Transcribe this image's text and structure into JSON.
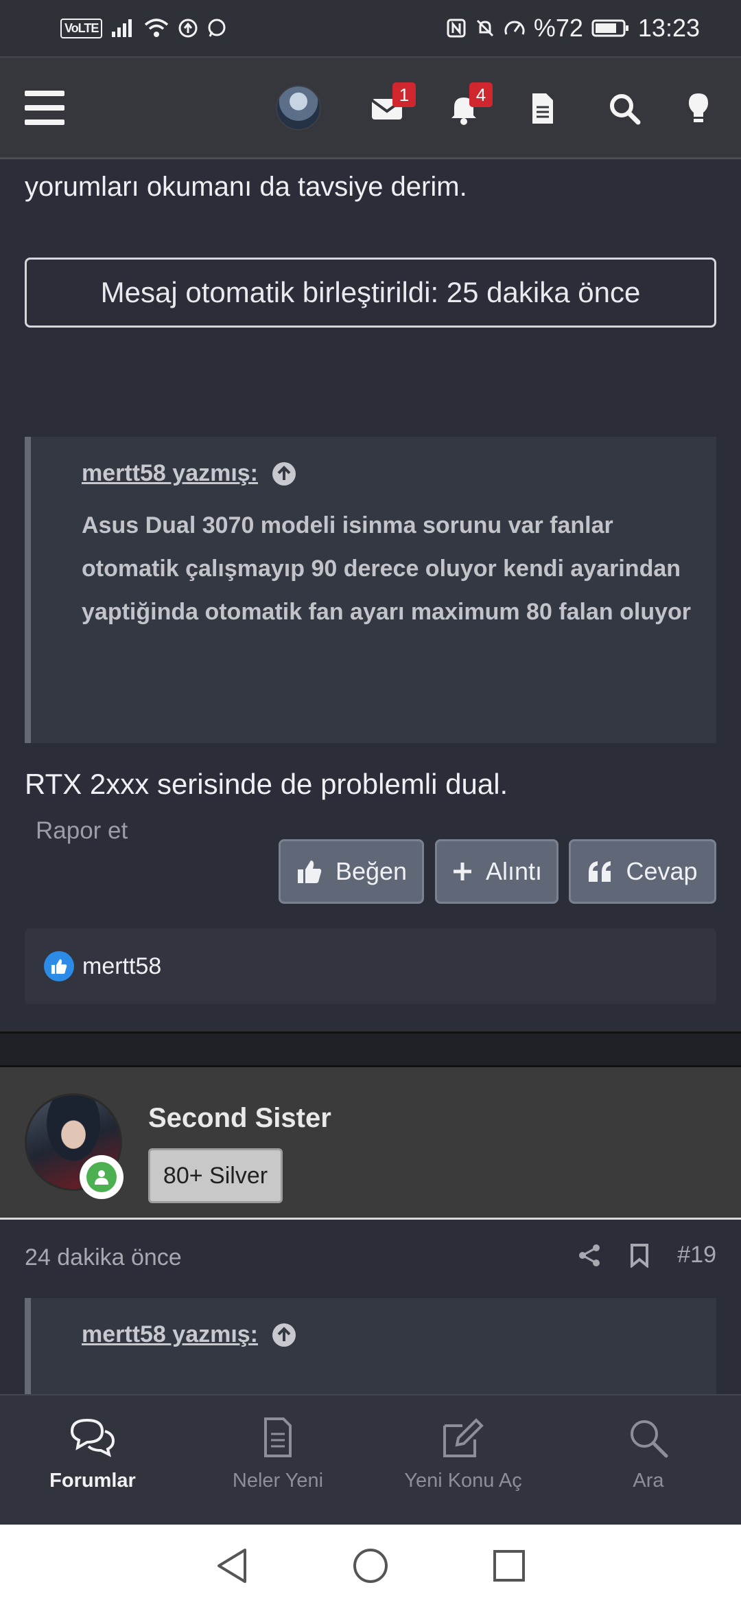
{
  "status_bar": {
    "network": "VoLTE",
    "battery": "%72",
    "time": "13:23"
  },
  "header": {
    "badges": {
      "messages": "1",
      "alerts": "4"
    }
  },
  "post1": {
    "lead_text": "yorumları okumanı da tavsiye derim.",
    "merged_notice": "Mesaj otomatik birleştirildi: 25 dakika önce",
    "quote": {
      "author": "mertt58 yazmış:",
      "body": "Asus Dual 3070 modeli isinma sorunu var fanlar otomatik çalışmayıp 90 derece oluyor kendi ayarindan yaptiğinda otomatik fan ayarı maximum 80 falan oluyor"
    },
    "reply": "RTX 2xxx serisinde de problemli dual.",
    "report_label": "Rapor et",
    "buttons": {
      "like": "Beğen",
      "quote": "Alıntı",
      "reply": "Cevap"
    },
    "likes": "mertt58"
  },
  "post2": {
    "username": "Second Sister",
    "user_title": "80+ Silver",
    "time": "24 dakika önce",
    "post_number": "#19",
    "quote_author": "mertt58 yazmış:"
  },
  "bottom_nav": [
    {
      "label": "Forumlar",
      "icon": "forums-icon",
      "active": true
    },
    {
      "label": "Neler Yeni",
      "icon": "document-icon",
      "active": false
    },
    {
      "label": "Yeni Konu Aç",
      "icon": "edit-icon",
      "active": false
    },
    {
      "label": "Ara",
      "icon": "search-icon",
      "active": false
    }
  ]
}
